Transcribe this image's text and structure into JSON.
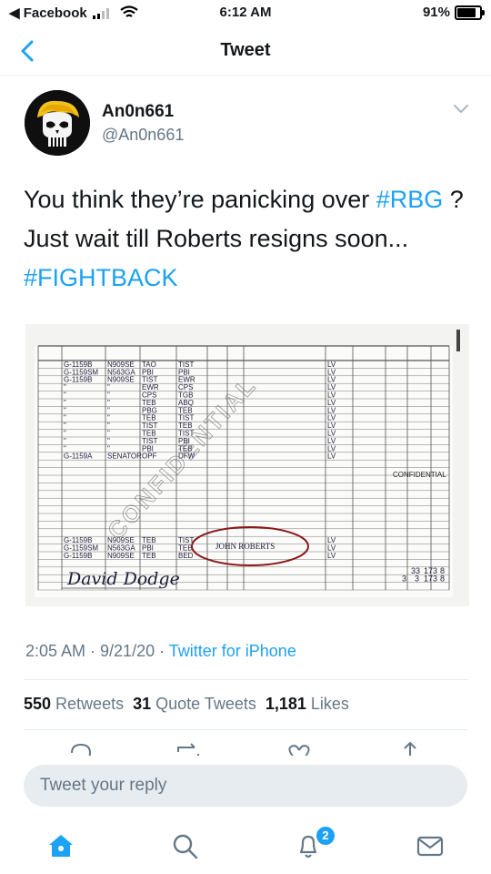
{
  "status_bar": {
    "back_app": "◀ Facebook",
    "time": "6:12 AM",
    "battery": "91%",
    "battery_level": 0.91
  },
  "nav": {
    "title": "Tweet"
  },
  "tweet": {
    "display_name": "An0n661",
    "handle": "@An0n661",
    "text_part1": "You think they’re panicking over ",
    "hashtag1": "#RBG",
    "text_part2": " ? Just wait till Roberts resigns soon... ",
    "hashtag2": "#FIGHTBACK",
    "image": {
      "stamp": "CONFIDENTIAL",
      "margin_note": "CONFIDENTIAL",
      "circled_name": "JOHN ROBERTS",
      "signature": "David Dodge",
      "rows": [
        [
          "G-1159B",
          "N909SE",
          "TAO",
          "TIST",
          "LV"
        ],
        [
          "G-1159SM",
          "N563GA",
          "PBI",
          "PBI",
          "LV"
        ],
        [
          "G-1159B",
          "N909SE",
          "TIST",
          "EWR",
          "LV"
        ],
        [
          "\"",
          "\"",
          "EWR",
          "CPS",
          "LV"
        ],
        [
          "\"",
          "\"",
          "CPS",
          "TGB",
          "LV"
        ],
        [
          "\"",
          "\"",
          "TEB",
          "ABQ",
          "LV"
        ],
        [
          "\"",
          "\"",
          "PBG",
          "TEB",
          "LV"
        ],
        [
          "\"",
          "\"",
          "TEB",
          "TIST",
          "LV"
        ],
        [
          "\"",
          "\"",
          "TIST",
          "TEB",
          "LV"
        ],
        [
          "\"",
          "\"",
          "TEB",
          "TIST",
          "LV"
        ],
        [
          "\"",
          "\"",
          "TIST",
          "PBI",
          "LV"
        ],
        [
          "\"",
          "\"",
          "PBI",
          "TEB",
          "LV"
        ],
        [
          "G-1159A",
          "SENATOR",
          "OPF",
          "DFW",
          "LV"
        ]
      ],
      "bottom_rows": [
        [
          "G-1159B",
          "N909SE",
          "TEB",
          "TIST",
          "LV"
        ],
        [
          "G-1159SM",
          "N563GA",
          "PBI",
          "TEB",
          "LV"
        ],
        [
          "G-1159B",
          "N909SE",
          "TEB",
          "BED",
          "LV"
        ]
      ],
      "totals": [
        "33",
        "173",
        "8",
        "3",
        "3",
        "173",
        "8"
      ]
    },
    "timestamp": "2:05 AM · 9/21/20 · ",
    "source": "Twitter for iPhone"
  },
  "stats": {
    "retweets_count": "550",
    "retweets_label": "Retweets",
    "quotes_count": "31",
    "quotes_label": "Quote Tweets",
    "likes_count": "1,181",
    "likes_label": "Likes"
  },
  "reply": {
    "placeholder": "Tweet your reply"
  },
  "tabbar": {
    "notifications_badge": "2"
  },
  "colors": {
    "accent": "#1da1f2",
    "text": "#14171a",
    "secondary": "#657786",
    "ink": "#1c1c3a",
    "circle": "#8b1a1a"
  }
}
